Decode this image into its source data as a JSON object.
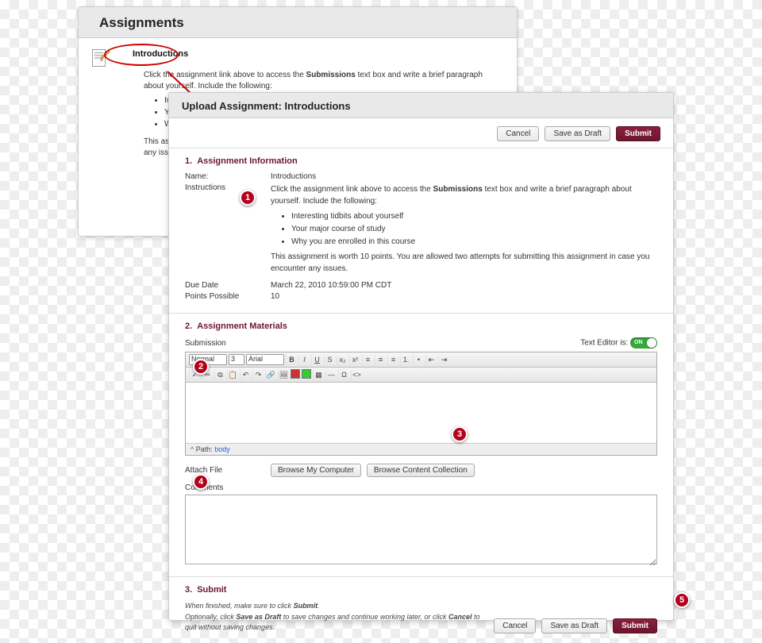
{
  "back_panel": {
    "title": "Assignments",
    "link": "Introductions",
    "intro_pre": "Click the assignment link above to access the ",
    "intro_bold": "Submissions",
    "intro_post": " text box and write a brief paragraph about yourself. Include the following:",
    "bullets": [
      "Interesting tidbits about yourself",
      "Your major course of study",
      "Why you are enrolled in this course"
    ],
    "footer_a": "This assignment",
    "footer_b": "any issues."
  },
  "front_panel": {
    "title": "Upload Assignment: Introductions",
    "buttons": {
      "cancel": "Cancel",
      "draft": "Save as Draft",
      "submit": "Submit"
    },
    "section1": {
      "num": "1.",
      "heading": "Assignment Information",
      "name_label": "Name:",
      "name_value": "Introductions",
      "instructions_label": "Instructions",
      "instr_pre": "Click the assignment link above to access the ",
      "instr_bold": "Submissions",
      "instr_post": " text box and write a brief paragraph about yourself. Include the following:",
      "bullets": [
        "Interesting tidbits about yourself",
        "Your major course of study",
        "Why you are enrolled in this course"
      ],
      "worth": "This assignment is worth 10 points. You are allowed two attempts for submitting this assignment in case you encounter any issues.",
      "due_label": "Due Date",
      "due_value": "March 22, 2010 10:59:00 PM CDT",
      "points_label": "Points Possible",
      "points_value": "10"
    },
    "section2": {
      "num": "2.",
      "heading": "Assignment Materials",
      "submission_label": "Submission",
      "text_editor_label": "Text Editor is:",
      "toggle": "ON",
      "format_sel": "Normal",
      "size_sel": "3",
      "font_sel": "Arial",
      "path_label": "Path: ",
      "path_body": "body",
      "attach_label": "Attach File",
      "browse_computer": "Browse My Computer",
      "browse_collection": "Browse Content Collection",
      "comments_label": "Comments"
    },
    "section3": {
      "num": "3.",
      "heading": "Submit",
      "line1_a": "When finished, make sure to click ",
      "line1_b": "Submit",
      "line1_c": ".",
      "line2_a": "Optionally, click ",
      "line2_b": "Save as Draft",
      "line2_c": " to save changes and continue working later, or click ",
      "line2_d": "Cancel",
      "line2_e": " to quit without saving changes."
    }
  },
  "callouts": {
    "c1": "1",
    "c2": "2",
    "c3": "3",
    "c4": "4",
    "c5": "5"
  }
}
